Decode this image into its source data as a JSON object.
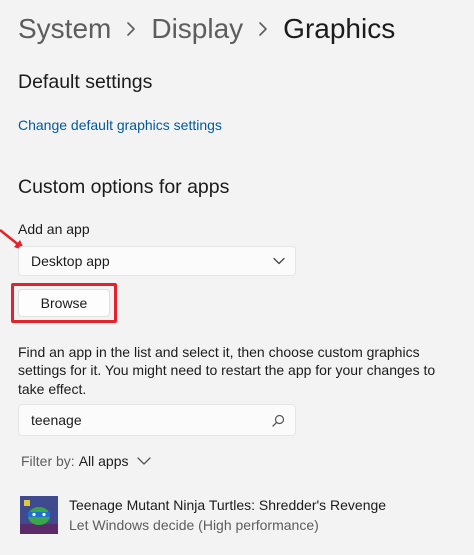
{
  "breadcrumb": {
    "items": [
      "System",
      "Display",
      "Graphics"
    ]
  },
  "default_settings": {
    "heading": "Default settings",
    "link": "Change default graphics settings"
  },
  "custom_options": {
    "heading": "Custom options for apps",
    "add_app_label": "Add an app",
    "app_type_value": "Desktop app",
    "browse_label": "Browse",
    "description": "Find an app in the list and select it, then choose custom graphics settings for it. You might need to restart the app for your changes to take effect.",
    "search_value": "teenage",
    "filter_label": "Filter by:",
    "filter_value": "All apps"
  },
  "apps": [
    {
      "name": "Teenage Mutant Ninja Turtles: Shredder's Revenge",
      "setting": "Let Windows decide (High performance)"
    }
  ],
  "colors": {
    "annotation_red": "#e5222b",
    "link_blue": "#005a9e",
    "app_icon_bg": "#3f4a8f"
  },
  "icons": [
    "chevron-right-icon",
    "chevron-down-icon",
    "search-icon",
    "arrow-annotation",
    "app-tile-icon"
  ]
}
